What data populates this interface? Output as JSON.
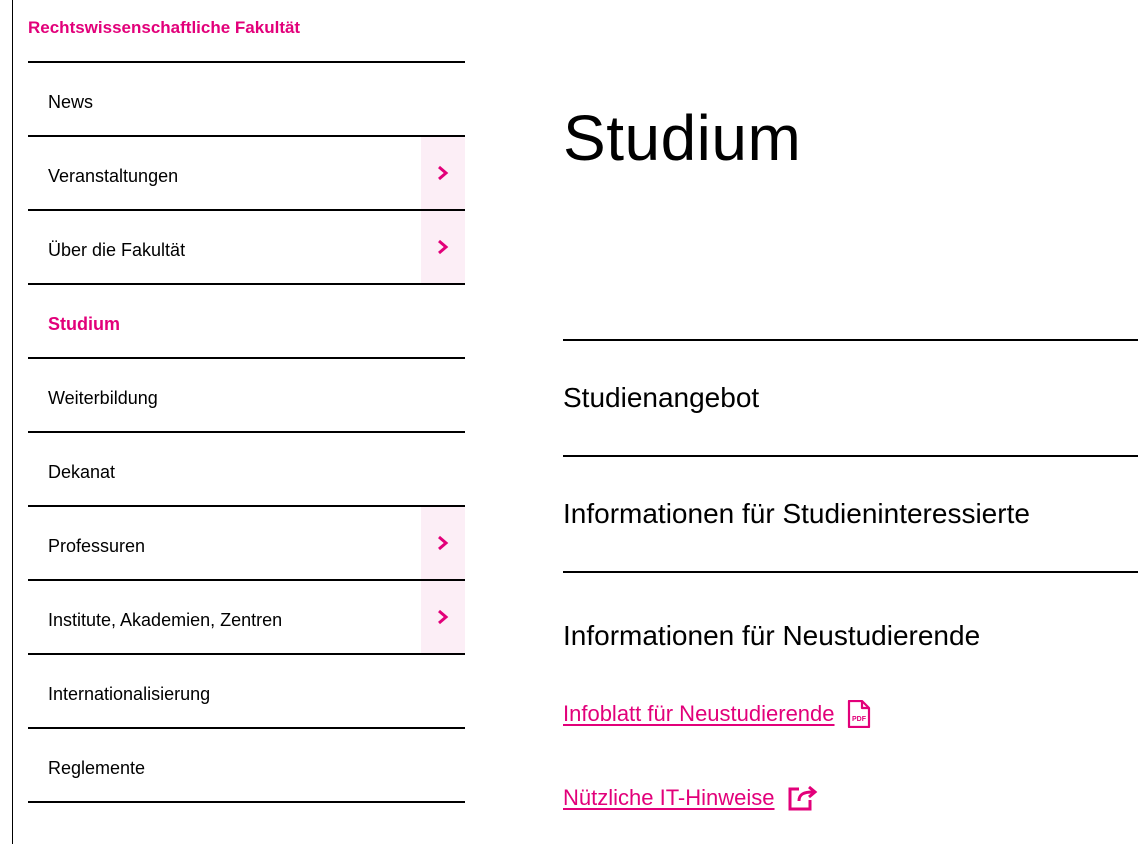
{
  "faculty": {
    "title": "Rechtswissenschaftliche Fakultät"
  },
  "sidebar": {
    "items": [
      {
        "label": "News",
        "has_submenu": false,
        "active": false
      },
      {
        "label": "Veranstaltungen",
        "has_submenu": true,
        "active": false
      },
      {
        "label": "Über die Fakultät",
        "has_submenu": true,
        "active": false
      },
      {
        "label": "Studium",
        "has_submenu": false,
        "active": true
      },
      {
        "label": "Weiterbildung",
        "has_submenu": false,
        "active": false
      },
      {
        "label": "Dekanat",
        "has_submenu": false,
        "active": false
      },
      {
        "label": "Professuren",
        "has_submenu": true,
        "active": false
      },
      {
        "label": "Institute, Akademien, Zentren",
        "has_submenu": true,
        "active": false
      },
      {
        "label": "Internationalisierung",
        "has_submenu": false,
        "active": false
      },
      {
        "label": "Reglemente",
        "has_submenu": false,
        "active": false
      }
    ]
  },
  "main": {
    "title": "Studium",
    "sections": [
      {
        "label": "Studienangebot"
      },
      {
        "label": "Informationen für Studieninteressierte"
      },
      {
        "label": "Informationen für Neustudierende"
      }
    ],
    "links": [
      {
        "label": "Infoblatt für Neustudierende",
        "icon": "pdf-icon",
        "icon_text": "PDF"
      },
      {
        "label": "Nützliche IT-Hinweise",
        "icon": "external-link-icon"
      }
    ]
  },
  "colors": {
    "accent": "#e2007a",
    "accent_light": "#fceef6",
    "text": "#000000"
  }
}
